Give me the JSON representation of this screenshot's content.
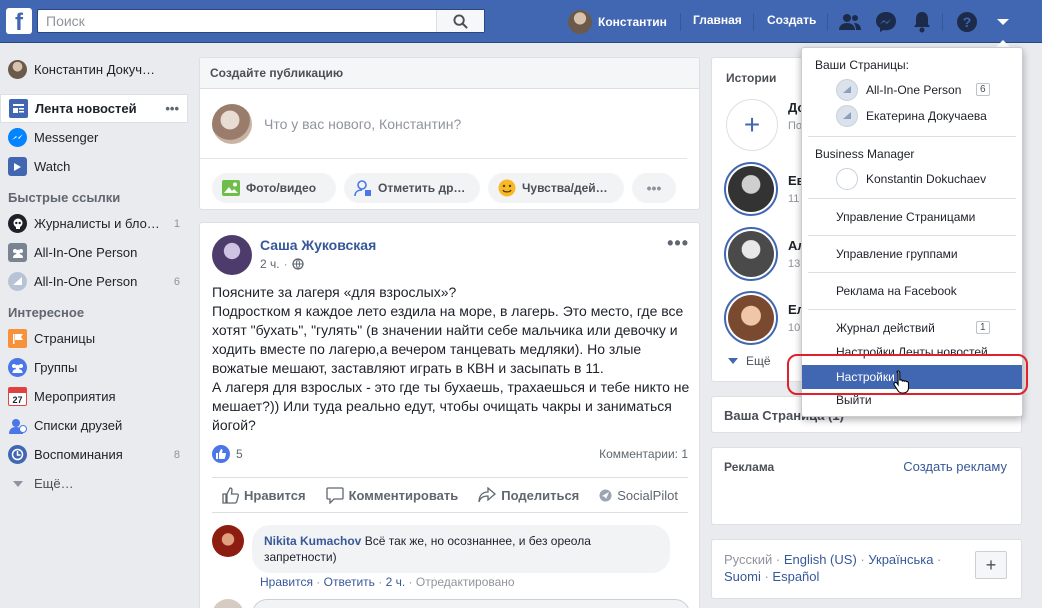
{
  "topbar": {
    "search_placeholder": "Поиск",
    "user_name": "Константин",
    "home": "Главная",
    "create": "Создать"
  },
  "sidebar": {
    "profile": "Константин Докуч…",
    "items": [
      {
        "label": "Лента новостей",
        "icon": "news-feed-icon"
      },
      {
        "label": "Messenger",
        "icon": "messenger-icon"
      },
      {
        "label": "Watch",
        "icon": "watch-icon"
      }
    ],
    "shortcuts_title": "Быстрые ссылки",
    "shortcuts": [
      {
        "label": "Журналисты и бло…",
        "count": "1"
      },
      {
        "label": "All-In-One Person",
        "count": ""
      },
      {
        "label": "All-In-One Person",
        "count": "6"
      }
    ],
    "explore_title": "Интересное",
    "explore": [
      {
        "label": "Страницы",
        "count": ""
      },
      {
        "label": "Группы",
        "count": ""
      },
      {
        "label": "Мероприятия",
        "count": ""
      },
      {
        "label": "Списки друзей",
        "count": ""
      },
      {
        "label": "Воспоминания",
        "count": "8"
      }
    ],
    "more": "Ещё…"
  },
  "composer": {
    "title": "Создайте публикацию",
    "placeholder": "Что у вас нового, Константин?",
    "photo": "Фото/видео",
    "tag": "Отметить др…",
    "feeling": "Чувства/дей…"
  },
  "post": {
    "author": "Саша Жуковская",
    "time": "2 ч.",
    "text": "Поясните за лагеря «для взрослых»?\nПодростком я каждое лето ездила на море, в лагерь. Это место, где все хотят \"бухать\", \"гулять\" (в значении найти себе мальчика или девочку и ходить вместе по лагерю,а вечером танцевать медляки). Но злые вожатые мешают, заставляют играть в КВН и засыпать в 11.\nА лагеря для взрослых - это где ты бухаешь, трахаешься и тебе никто не мешает?)) Или туда реально едут, чтобы очищать чакры и заниматься йогой?",
    "likes": "5",
    "comments": "Комментарии: 1",
    "like": "Нравится",
    "comment": "Комментировать",
    "share": "Поделиться",
    "socialpilot": "SocialPilot",
    "comment1": {
      "author": "Nikita Kumachov",
      "text": "Всё так же, но осознаннее, и без ореола запретности)",
      "like": "Нравится",
      "reply": "Ответить",
      "time": "2 ч.",
      "edited": "Отредактировано"
    }
  },
  "stories": {
    "title": "Истории",
    "add_name": "До",
    "add_sub": "По",
    "list": [
      {
        "name": "Ев",
        "sub": "11"
      },
      {
        "name": "Ал",
        "sub": "13"
      },
      {
        "name": "Ел",
        "sub": "10"
      }
    ],
    "more": "Ещё"
  },
  "your_page": "Ваша Страница (1)",
  "ads": {
    "title": "Реклама",
    "create": "Создать рекламу"
  },
  "languages": {
    "current": "Русский",
    "list": [
      "English (US)",
      "Українська",
      "Suomi",
      "Español"
    ]
  },
  "dropdown": {
    "your_pages": "Ваши Страницы:",
    "pages": [
      {
        "name": "All-In-One Person",
        "badge": "6"
      },
      {
        "name": "Екатерина Докучаева",
        "badge": ""
      }
    ],
    "business_manager": "Business Manager",
    "bm_account": "Konstantin Dokuchaev",
    "manage_pages": "Управление Страницами",
    "manage_groups": "Управление группами",
    "ads": "Реклама на Facebook",
    "activity_log": "Журнал действий",
    "activity_badge": "1",
    "news_prefs": "Настройки Ленты новостей",
    "settings": "Настройки",
    "logout": "Выйти"
  },
  "colors": {
    "brand": "#4267b2",
    "highlight_box": "#e0202a"
  }
}
